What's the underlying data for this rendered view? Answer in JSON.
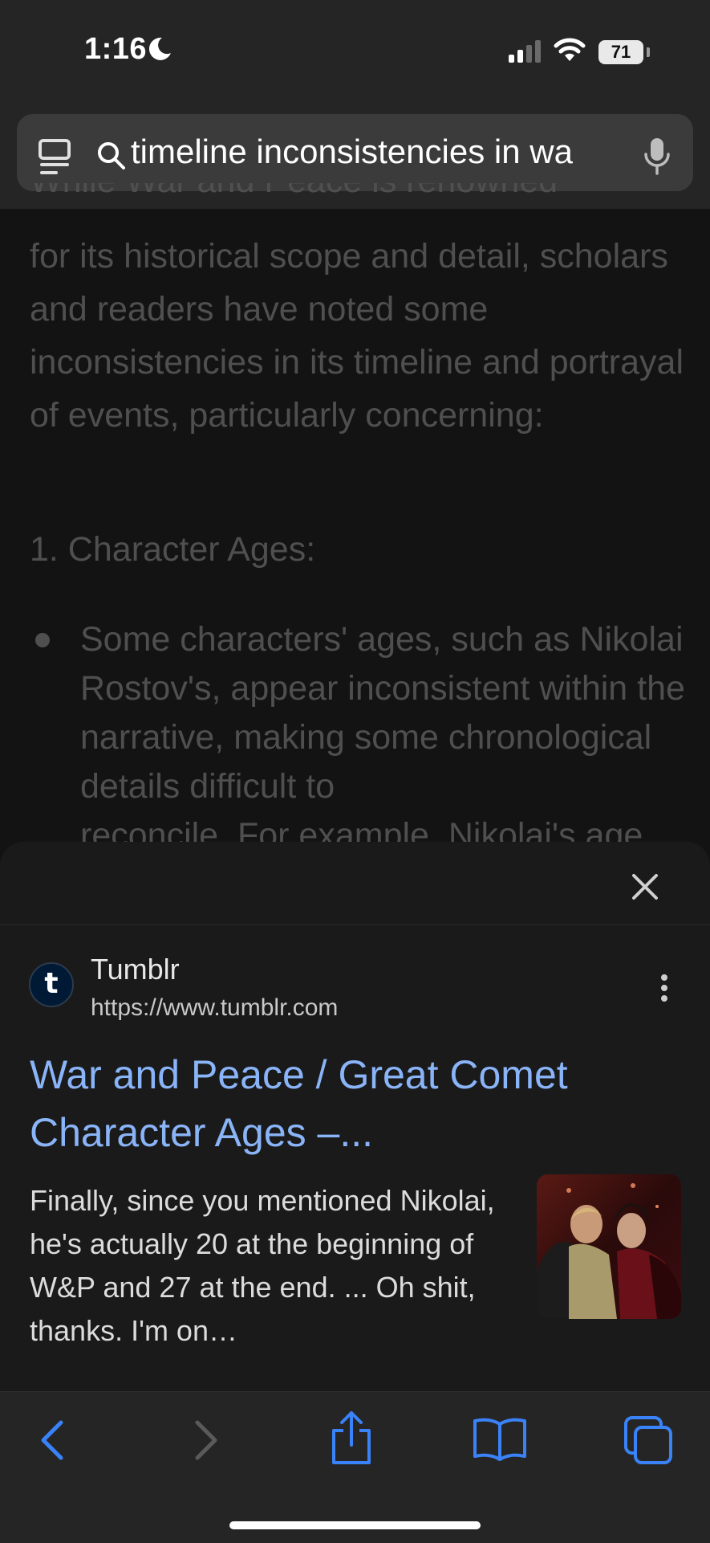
{
  "status_bar": {
    "time": "1:16",
    "battery": "71"
  },
  "url_bar": {
    "query": "timeline inconsistencies in wa"
  },
  "article": {
    "cut_line": "While War and Peace is renowned",
    "paragraph": "for its historical scope and detail, scholars and readers have noted some inconsistencies in its timeline and portrayal of events, particularly concerning:",
    "heading": "1. Character Ages:",
    "bullet": "Some characters' ages, such as Nikolai Rostov's, appear inconsistent within the narrative, making some chronological details difficult to",
    "bullet_cut": "reconcile. For example, Nikolai's age"
  },
  "result": {
    "favicon_letter": "t",
    "site_name": "Tumblr",
    "site_url": "https://www.tumblr.com",
    "title": "War and Peace / Great Comet Character Ages –...",
    "snippet": "Finally, since you mentioned Nikolai, he's actually 20 at the beginning of W&P and 27 at the end. ... Oh shit, thanks. I'm on…"
  },
  "colors": {
    "link": "#8ab4f8",
    "toolbar_icon_active": "#3a82f7",
    "toolbar_icon_disabled": "#5a5a5a",
    "faded_text": "#4f4f4f"
  },
  "icons": {
    "reader": "reader-icon",
    "search": "search-icon",
    "mic": "mic-icon",
    "close": "close-icon",
    "more": "more-vertical-icon",
    "back": "chevron-left-icon",
    "forward": "chevron-right-icon",
    "share": "share-icon",
    "bookmarks": "book-icon",
    "tabs": "tabs-icon"
  }
}
